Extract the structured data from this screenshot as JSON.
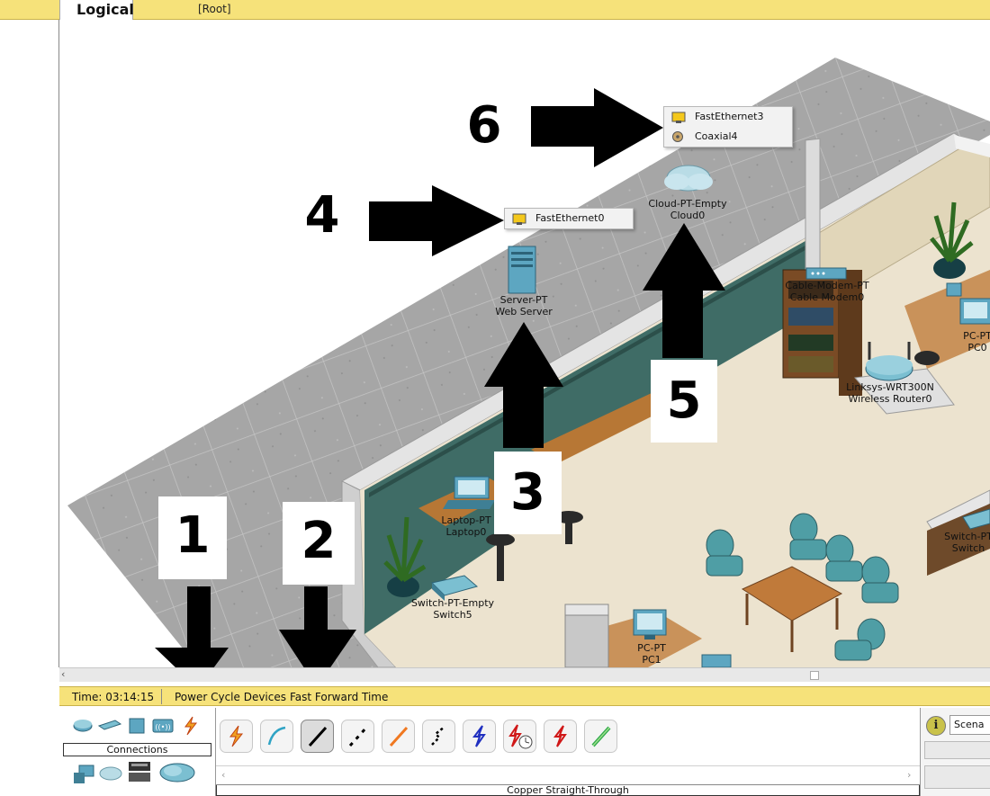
{
  "top_bar": {
    "tab_label": "Logical",
    "root_label": "[Root]"
  },
  "devices": {
    "server": {
      "model": "Server-PT",
      "name": "Web Server"
    },
    "cloud": {
      "model": "Cloud-PT-Empty",
      "name": "Cloud0"
    },
    "cable_modem": {
      "model": "Cable-Modem-PT",
      "name": "Cable Modem0"
    },
    "router": {
      "model": "Linksys-WRT300N",
      "name": "Wireless Router0"
    },
    "pc0": {
      "model": "PC-PT",
      "name": "PC0"
    },
    "pc1": {
      "model": "PC-PT",
      "name": "PC1"
    },
    "laptop": {
      "model": "Laptop-PT",
      "name": "Laptop0"
    },
    "switch5": {
      "model": "Switch-PT-Empty",
      "name": "Switch5"
    },
    "switch_right": {
      "model": "Switch-PT",
      "name": "Switch"
    }
  },
  "popups": {
    "server_ports": [
      "FastEthernet0"
    ],
    "cloud_ports": [
      "FastEthernet3",
      "Coaxial4"
    ]
  },
  "annotations": {
    "n1": "1",
    "n2": "2",
    "n3": "3",
    "n4": "4",
    "n5": "5",
    "n6": "6"
  },
  "status_bar": {
    "time": "Time: 03:14:15",
    "power_cycle": "Power Cycle Devices",
    "fast_forward": "Fast Forward Time"
  },
  "bottom": {
    "category_label": "Connections",
    "selected_cable": "Copper Straight-Through",
    "scenario": "Scena"
  },
  "cable_types": [
    "Automatically Choose Connection Type",
    "Console",
    "Copper Straight-Through",
    "Copper Cross-Over",
    "Fiber",
    "Phone",
    "Coaxial",
    "Serial DCE",
    "Serial DTE",
    "Octal"
  ]
}
